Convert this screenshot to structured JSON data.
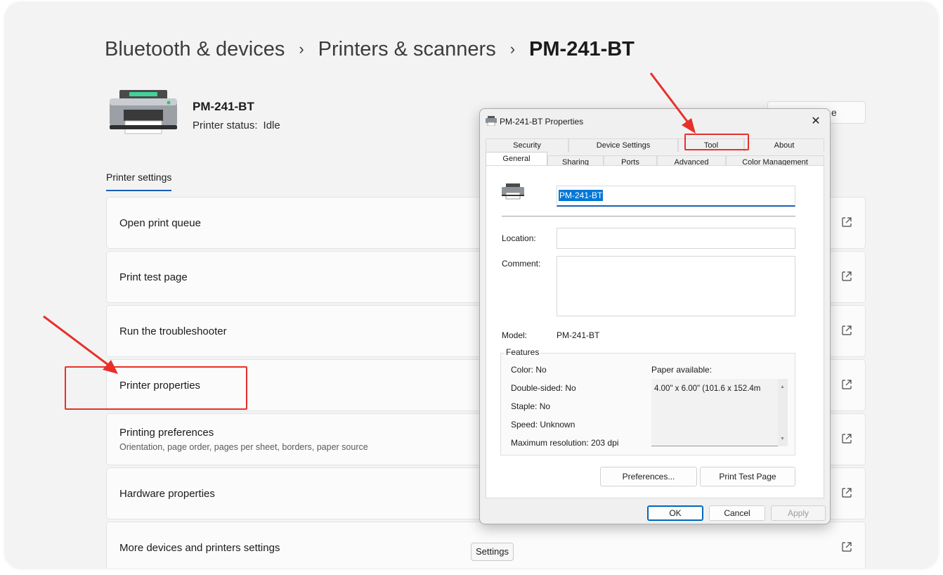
{
  "breadcrumb": {
    "items": [
      "Bluetooth & devices",
      "Printers & scanners"
    ],
    "separator": "›",
    "current": "PM-241-BT"
  },
  "printer": {
    "name": "PM-241-BT",
    "status_label": "Printer status:",
    "status_value": "Idle"
  },
  "header_button_partial": "e",
  "section_tab": "Printer settings",
  "rows": [
    {
      "label": "Open print queue",
      "icon": "open-external-icon"
    },
    {
      "label": "Print test page",
      "icon": "open-external-icon"
    },
    {
      "label": "Run the troubleshooter",
      "icon": "open-external-icon"
    },
    {
      "label": "Printer properties",
      "icon": "open-external-icon"
    },
    {
      "label": "Printing preferences",
      "sublabel": "Orientation, page order, pages per sheet, borders, paper source",
      "icon": "open-external-icon"
    },
    {
      "label": "Hardware properties",
      "icon": "open-external-icon"
    },
    {
      "label": "More devices and printers settings",
      "icon": "open-external-icon"
    }
  ],
  "tooltip": "Settings",
  "annotation_color": "#e8302a",
  "dialog": {
    "title": "PM-241-BT Properties",
    "close": "✕",
    "tabs_top": [
      "Security",
      "Device Settings",
      "Tool",
      "About"
    ],
    "tabs_bottom": [
      "General",
      "Sharing",
      "Ports",
      "Advanced",
      "Color Management"
    ],
    "active_tab": "General",
    "printer_name_value": "PM-241-BT",
    "location_label": "Location:",
    "comment_label": "Comment:",
    "model_label": "Model:",
    "model_value": "PM-241-BT",
    "features": {
      "legend": "Features",
      "color": "Color: No",
      "double_sided": "Double-sided: No",
      "staple": "Staple: No",
      "speed": "Speed: Unknown",
      "max_resolution": "Maximum resolution: 203 dpi",
      "paper_label": "Paper available:",
      "paper_items": [
        "4.00\" x 6.00\" (101.6 x 152.4m"
      ]
    },
    "buttons": {
      "preferences": "Preferences...",
      "print_test_page": "Print Test Page",
      "ok": "OK",
      "cancel": "Cancel",
      "apply": "Apply"
    }
  }
}
